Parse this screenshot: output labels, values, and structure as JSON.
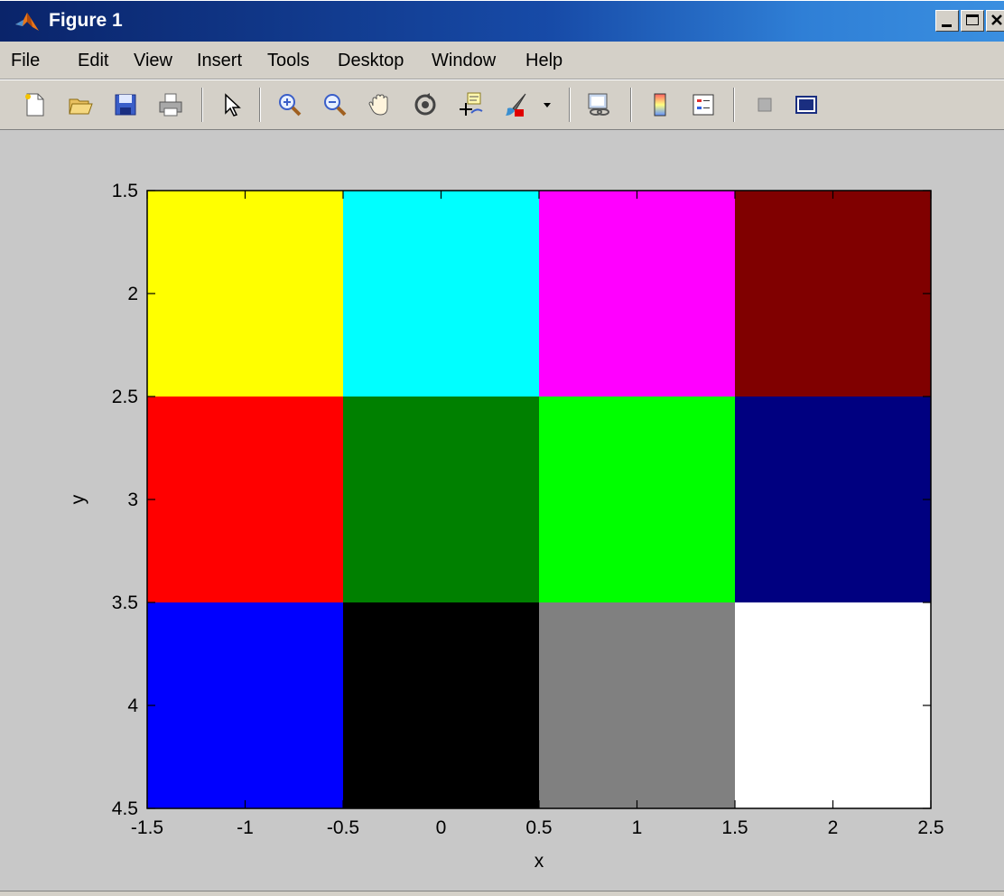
{
  "window": {
    "title": "Figure 1",
    "icon": "matlab-logo-icon",
    "controls": [
      "minimize-icon",
      "maximize-icon",
      "close-icon"
    ]
  },
  "menu": {
    "items": [
      "File",
      "Edit",
      "View",
      "Insert",
      "Tools",
      "Desktop",
      "Window",
      "Help"
    ]
  },
  "toolbar": {
    "icons": [
      "new-figure-icon",
      "open-file-icon",
      "save-icon",
      "print-icon",
      "edit-plot-arrow-icon",
      "zoom-in-icon",
      "zoom-out-icon",
      "pan-hand-icon",
      "rotate-3d-icon",
      "data-cursor-icon",
      "brush-icon",
      "brush-dropdown-icon",
      "link-plot-icon",
      "insert-colorbar-icon",
      "insert-legend-icon",
      "hide-plot-tools-icon",
      "show-plot-tools-icon"
    ]
  },
  "chart_data": {
    "type": "heatmap",
    "title": "",
    "xlabel": "x",
    "ylabel": "y",
    "xlim": [
      -1.5,
      2.5
    ],
    "ylim": [
      1.5,
      4.5
    ],
    "y_reversed": true,
    "xticks": [
      -1.5,
      -1,
      -0.5,
      0,
      0.5,
      1,
      1.5,
      2,
      2.5
    ],
    "xtick_labels": [
      "-1.5",
      "-1",
      "-0.5",
      "0",
      "0.5",
      "1",
      "1.5",
      "2",
      "2.5"
    ],
    "yticks": [
      1.5,
      2,
      2.5,
      3,
      3.5,
      4,
      4.5
    ],
    "ytick_labels": [
      "1.5",
      "2",
      "2.5",
      "3",
      "3.5",
      "4",
      "4.5"
    ],
    "x_centers": [
      -1,
      0,
      1,
      2
    ],
    "y_centers": [
      2,
      3,
      4
    ],
    "cell_width": 1,
    "cell_height": 1,
    "cells": [
      [
        "#ffff00",
        "#00ffff",
        "#ff00ff",
        "#800000"
      ],
      [
        "#ff0000",
        "#008000",
        "#00ff00",
        "#000080"
      ],
      [
        "#0000ff",
        "#000000",
        "#808080",
        "#ffffff"
      ]
    ],
    "grid": false
  },
  "colors": {
    "figure_background": "#c8c8c8",
    "axes_line": "#000000",
    "title_bar": "#0a246a"
  }
}
